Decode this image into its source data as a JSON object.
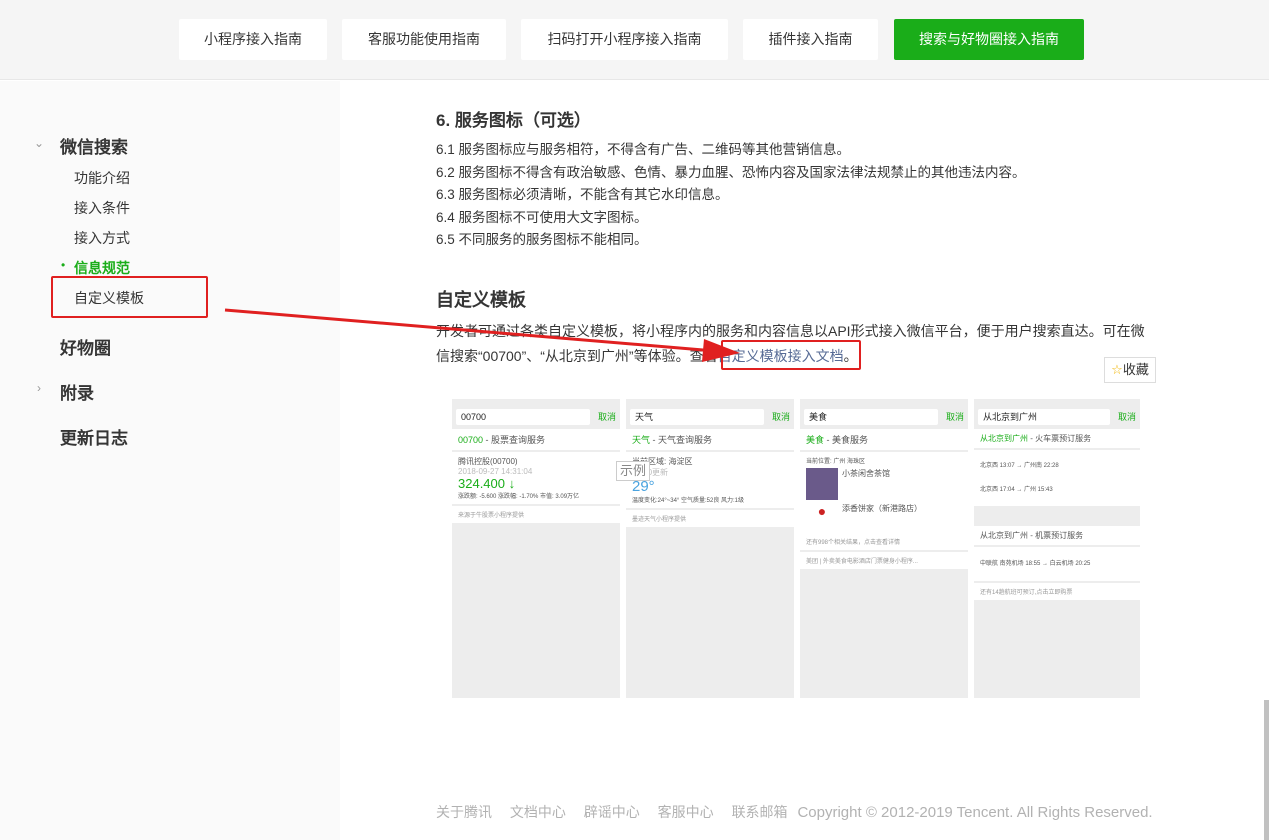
{
  "tabs": [
    "小程序接入指南",
    "客服功能使用指南",
    "扫码打开小程序接入指南",
    "插件接入指南",
    "搜索与好物圈接入指南"
  ],
  "sidebar": {
    "section1": "微信搜索",
    "items": [
      "功能介绍",
      "接入条件",
      "接入方式",
      "信息规范",
      "自定义模板"
    ],
    "section2": "好物圈",
    "section3": "附录",
    "section4": "更新日志"
  },
  "content": {
    "h1": "6. 服务图标（可选）",
    "rules": [
      "6.1 服务图标应与服务相符，不得含有广告、二维码等其他营销信息。",
      "6.2 服务图标不得含有政治敏感、色情、暴力血腥、恐怖内容及国家法律法规禁止的其他违法内容。",
      "6.3 服务图标必须清晰，不能含有其它水印信息。",
      "6.4 服务图标不可使用大文字图标。",
      "6.5 不同服务的服务图标不能相同。"
    ],
    "h2": "自定义模板",
    "para1": "开发者可通过各类自定义模板，将小程序内的服务和内容信息以API形式接入微信平台，便于用户搜索直达。可在微",
    "para2": "信搜索“00700”、“从北京到广州”等体验。查看",
    "link": "自定义模板接入文档",
    "period": "。",
    "fav": "收藏",
    "example": "示例"
  },
  "phones": [
    {
      "query": "00700",
      "cancel": "取消",
      "kw": "00700",
      "title": " - 股票查询服务",
      "l1": "腾讯控股(00700)",
      "l2": "2018-09-27 14:31:04",
      "big": "324.400 ↓",
      "l3": "涨跌额: -5.600  涨跌幅: -1.70%  市值: 3.09万亿",
      "src": "来源于牛股票小程序提供"
    },
    {
      "query": "天气",
      "cancel": "取消",
      "kw": "天气",
      "title": " - 天气查询服务",
      "l1": "当前区域: 海淀区",
      "l2": "10:00更新",
      "big": "29°",
      "l3": "温度变化:24°~34°  空气质量:52良  风力:1级",
      "src": "墨迹天气小程序提供"
    },
    {
      "query": "美食",
      "cancel": "取消",
      "kw": "美食",
      "title": " - 美食服务",
      "l1": "当前位置: 广州 海珠区",
      "l2": "小茶闲舍茶馆",
      "big": "添香饼家（新港路店）",
      "l3": "还有998个相关结果，点击查看详情",
      "src": "美团 | 外卖美食电影酒店门票健身小程序..."
    },
    {
      "query": "从北京到广州",
      "cancel": "取消",
      "kw": "从北京到广州",
      "title": " - 火车票预订服务",
      "l1": "北京西 13:07 → 广州南 22:28",
      "l2": "北京西 17:04 → 广州 15:43",
      "big": "从北京到广州 - 机票预订服务",
      "l3": "中联航 南苑机场 18:55 → 白云机场 20:25",
      "src": "还有14趟航班可预订,点击立即购票"
    }
  ],
  "footer": {
    "links": [
      "关于腾讯",
      "文档中心",
      "辟谣中心",
      "客服中心",
      "联系邮箱"
    ],
    "copyright": "Copyright © 2012-2019 Tencent. All Rights Reserved."
  },
  "colors": {
    "accent": "#1aad19",
    "annotation": "#e02020",
    "link": "#576b95"
  }
}
